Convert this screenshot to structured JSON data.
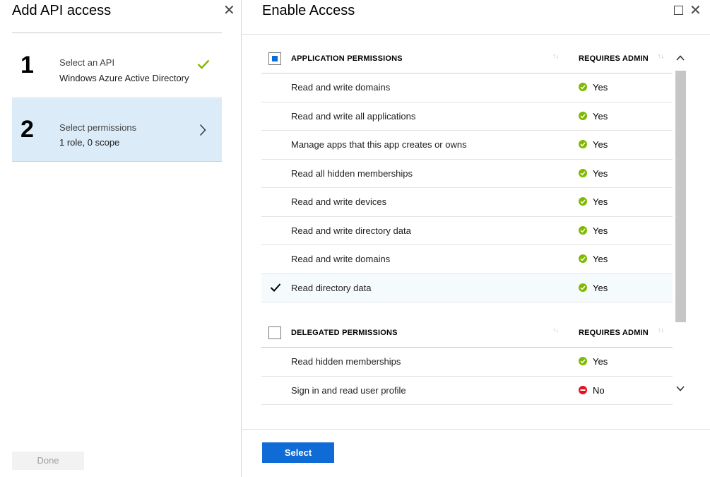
{
  "left_blade": {
    "title": "Add API access",
    "steps": [
      {
        "number": "1",
        "title": "Select an API",
        "subtitle": "Windows Azure Active Directory",
        "status_icon": "checkmark-icon"
      },
      {
        "number": "2",
        "title": "Select permissions",
        "subtitle": "1 role, 0 scope",
        "status_icon": "chevron-right-icon"
      }
    ],
    "done_label": "Done"
  },
  "right_blade": {
    "title": "Enable Access",
    "application_permissions": {
      "header": "APPLICATION PERMISSIONS",
      "admin_header": "REQUIRES ADMIN",
      "rows": [
        {
          "label": "Read and write domains",
          "requires_admin": "Yes",
          "checked": false
        },
        {
          "label": "Read and write all applications",
          "requires_admin": "Yes",
          "checked": false
        },
        {
          "label": "Manage apps that this app creates or owns",
          "requires_admin": "Yes",
          "checked": false
        },
        {
          "label": "Read all hidden memberships",
          "requires_admin": "Yes",
          "checked": false
        },
        {
          "label": "Read and write devices",
          "requires_admin": "Yes",
          "checked": false
        },
        {
          "label": "Read and write directory data",
          "requires_admin": "Yes",
          "checked": false
        },
        {
          "label": "Read and write domains",
          "requires_admin": "Yes",
          "checked": false
        },
        {
          "label": "Read directory data",
          "requires_admin": "Yes",
          "checked": true
        }
      ]
    },
    "delegated_permissions": {
      "header": "DELEGATED PERMISSIONS",
      "admin_header": "REQUIRES ADMIN",
      "rows": [
        {
          "label": "Read hidden memberships",
          "requires_admin": "Yes",
          "checked": false
        },
        {
          "label": "Sign in and read user profile",
          "requires_admin": "No",
          "checked": false
        }
      ]
    },
    "select_label": "Select"
  },
  "colors": {
    "accent": "#0f6cd6",
    "selected_step_bg": "#dcebf8",
    "yes_green": "#7fba00",
    "no_red": "#e81123"
  }
}
